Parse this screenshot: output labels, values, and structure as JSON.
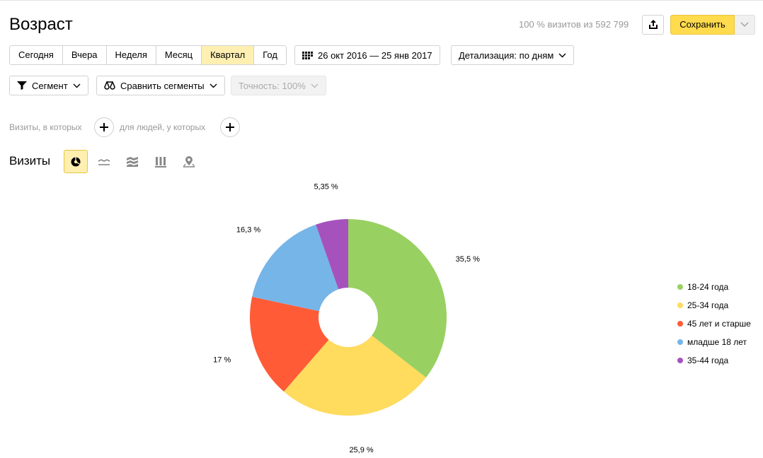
{
  "header": {
    "title": "Возраст",
    "visits_stat": "100 % визитов из 592 799",
    "save_label": "Сохранить"
  },
  "periods": [
    {
      "label": "Сегодня",
      "active": false
    },
    {
      "label": "Вчера",
      "active": false
    },
    {
      "label": "Неделя",
      "active": false
    },
    {
      "label": "Месяц",
      "active": false
    },
    {
      "label": "Квартал",
      "active": true
    },
    {
      "label": "Год",
      "active": false
    }
  ],
  "date_range": "26 окт 2016 — 25 янв 2017",
  "detail_label": "Детализация: по дням",
  "segment_label": "Сегмент",
  "compare_label": "Сравнить сегменты",
  "accuracy_label": "Точность: 100%",
  "filters": {
    "visits_label": "Визиты, в которых",
    "people_label": "для людей, у которых"
  },
  "section_title": "Визиты",
  "view_modes": [
    "pie-chart-icon",
    "line-chart-icon",
    "area-chart-icon",
    "bar-chart-icon",
    "map-icon"
  ],
  "chart_data": {
    "type": "pie",
    "donut": true,
    "title": "",
    "slices": [
      {
        "name": "18-24 года",
        "value": 35.5,
        "label": "35,5 %",
        "color": "#99d062"
      },
      {
        "name": "25-34 года",
        "value": 25.9,
        "label": "25,9 %",
        "color": "#ffdb5e"
      },
      {
        "name": "45 лет и старше",
        "value": 17,
        "label": "17 %",
        "color": "#ff5b37"
      },
      {
        "name": "младше 18 лет",
        "value": 16.3,
        "label": "16,3 %",
        "color": "#76b5e8"
      },
      {
        "name": "35-44 года",
        "value": 5.35,
        "label": "5,35 %",
        "color": "#a652bd"
      }
    ],
    "legend_position": "right"
  }
}
